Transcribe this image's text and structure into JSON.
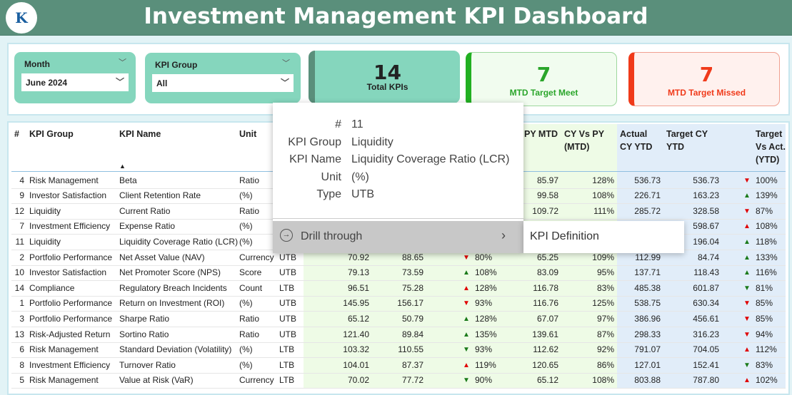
{
  "header": {
    "title": "Investment Management KPI Dashboard",
    "logo_text": "KPI"
  },
  "filters": {
    "month": {
      "label": "Month",
      "value": "June 2024"
    },
    "kpi_group": {
      "label": "KPI Group",
      "value": "All"
    }
  },
  "cards": {
    "total": {
      "value": "14",
      "label": "Total KPIs"
    },
    "meet": {
      "value": "7",
      "label": "MTD Target Meet",
      "color": "#2aa52a"
    },
    "missed": {
      "value": "7",
      "label": "MTD Target Missed",
      "color": "#f03a1a"
    }
  },
  "table": {
    "headers": {
      "num": "#",
      "group": "KPI Group",
      "name": "KPI Name",
      "unit": "Unit",
      "py_mtd": "PY MTD",
      "cy_vs_py": "CY Vs PY (MTD)",
      "act_ytd": "Actual CY YTD",
      "tgt_ytd": "Target CY YTD",
      "ytd_pct": "Target Vs Act. (YTD)"
    },
    "sort_indicator": "▲",
    "colors": {
      "up_green": "#1a7a1a",
      "red": "#e00000"
    },
    "rows": [
      [
        "4",
        "Risk Management",
        "Beta",
        "Ratio",
        "",
        "",
        "",
        "",
        "",
        "",
        "85.97",
        "128%",
        "536.73",
        "536.73",
        "down",
        "red",
        "100%"
      ],
      [
        "9",
        "Investor Satisfaction",
        "Client Retention Rate",
        " (%)",
        "",
        "",
        "",
        "",
        "",
        "",
        "99.58",
        "108%",
        "226.71",
        "163.23",
        "up",
        "green",
        "139%"
      ],
      [
        "12",
        "Liquidity",
        "Current Ratio",
        "Ratio",
        "",
        "",
        "",
        "",
        "",
        "",
        "109.72",
        "111%",
        "285.72",
        "328.58",
        "down",
        "red",
        "87%"
      ],
      [
        "7",
        "Investment Efficiency",
        "Expense Ratio",
        " (%)",
        "",
        "",
        "",
        "",
        "",
        "",
        "",
        "",
        "",
        "598.67",
        "up",
        "red",
        "108%"
      ],
      [
        "11",
        "Liquidity",
        "Liquidity Coverage Ratio (LCR)",
        " (%)",
        "",
        "",
        "",
        "",
        "",
        "",
        "",
        "",
        "",
        "196.04",
        "up",
        "green",
        "118%"
      ],
      [
        "2",
        "Portfolio Performance",
        "Net Asset Value (NAV)",
        "Currency",
        "UTB",
        "70.92",
        "88.65",
        "down",
        "red",
        "80%",
        "65.25",
        "109%",
        "112.99",
        "84.74",
        "up",
        "green",
        "133%"
      ],
      [
        "10",
        "Investor Satisfaction",
        "Net Promoter Score (NPS)",
        "Score",
        "UTB",
        "79.13",
        "73.59",
        "up",
        "green",
        "108%",
        "83.09",
        "95%",
        "137.71",
        "118.43",
        "up",
        "green",
        "116%"
      ],
      [
        "14",
        "Compliance",
        "Regulatory Breach Incidents",
        "Count",
        "LTB",
        "96.51",
        "75.28",
        "up",
        "red",
        "128%",
        "116.78",
        "83%",
        "485.38",
        "601.87",
        "down",
        "green",
        "81%"
      ],
      [
        "1",
        "Portfolio Performance",
        "Return on Investment (ROI)",
        " (%)",
        "UTB",
        "145.95",
        "156.17",
        "down",
        "red",
        "93%",
        "116.76",
        "125%",
        "538.75",
        "630.34",
        "down",
        "red",
        "85%"
      ],
      [
        "3",
        "Portfolio Performance",
        "Sharpe Ratio",
        "Ratio",
        "UTB",
        "65.12",
        "50.79",
        "up",
        "green",
        "128%",
        "67.07",
        "97%",
        "386.96",
        "456.61",
        "down",
        "red",
        "85%"
      ],
      [
        "13",
        "Risk-Adjusted Return",
        "Sortino Ratio",
        "Ratio",
        "UTB",
        "121.40",
        "89.84",
        "up",
        "green",
        "135%",
        "139.61",
        "87%",
        "298.33",
        "316.23",
        "down",
        "red",
        "94%"
      ],
      [
        "6",
        "Risk Management",
        "Standard Deviation (Volatility)",
        " (%)",
        "LTB",
        "103.32",
        "110.55",
        "down",
        "green",
        "93%",
        "112.62",
        "92%",
        "791.07",
        "704.05",
        "up",
        "red",
        "112%"
      ],
      [
        "8",
        "Investment Efficiency",
        "Turnover Ratio",
        " (%)",
        "LTB",
        "104.01",
        "87.37",
        "up",
        "red",
        "119%",
        "120.65",
        "86%",
        "127.01",
        "152.41",
        "down",
        "green",
        "83%"
      ],
      [
        "5",
        "Risk Management",
        "Value at Risk (VaR)",
        "Currency",
        "LTB",
        "70.02",
        "77.72",
        "down",
        "green",
        "90%",
        "65.12",
        "108%",
        "803.88",
        "787.80",
        "up",
        "red",
        "102%"
      ]
    ]
  },
  "tooltip": {
    "fields": [
      {
        "k": "#",
        "v": "11"
      },
      {
        "k": "KPI Group",
        "v": "Liquidity"
      },
      {
        "k": "KPI Name",
        "v": "Liquidity Coverage Ratio (LCR)"
      },
      {
        "k": "Unit",
        "v": "(%)"
      },
      {
        "k": "Type",
        "v": "UTB"
      }
    ],
    "drill_label": "Drill through",
    "submenu_item": "KPI Definition"
  }
}
